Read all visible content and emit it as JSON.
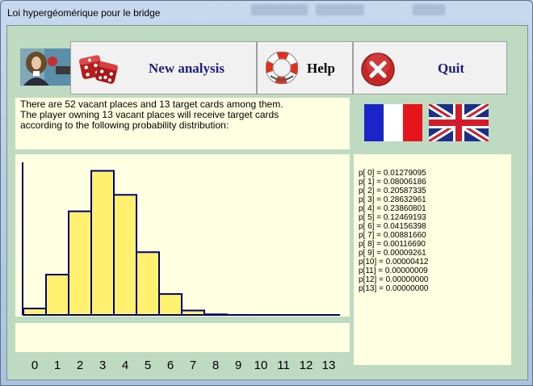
{
  "window": {
    "title": "Loi hypergéomérique pour le bridge"
  },
  "toolbar": {
    "new_analysis_label": "New analysis",
    "help_label": "Help",
    "quit_label": "Quit"
  },
  "info": {
    "lines": [
      "There are 52 vacant places and 13  target cards  among them.",
      "The player owning 13 vacant places will receive  target cards",
      "according to the following probability distribution:"
    ]
  },
  "probabilities": [
    "p[ 0] = 0.01279095",
    "p[ 1] = 0.08006186",
    "p[ 2] = 0.20587335",
    "p[ 3] = 0.28632961",
    "p[ 4] = 0.23860801",
    "p[ 5] = 0.12469193",
    "p[ 6] = 0.04156398",
    "p[ 7] = 0.00881660",
    "p[ 8] = 0.00116690",
    "p[ 9] = 0.00009261",
    "p[10] = 0.00000412",
    "p[11] = 0.00000009",
    "p[12] = 0.00000000",
    "p[13] = 0.00000000"
  ],
  "chart_data": {
    "type": "bar",
    "categories": [
      "0",
      "1",
      "2",
      "3",
      "4",
      "5",
      "6",
      "7",
      "8",
      "9",
      "10",
      "11",
      "12",
      "13"
    ],
    "values": [
      0.01279095,
      0.08006186,
      0.20587335,
      0.28632961,
      0.23860801,
      0.12469193,
      0.04156398,
      0.0088166,
      0.0011669,
      9.261e-05,
      4.12e-06,
      9e-08,
      0.0,
      0.0
    ],
    "ylim": [
      0,
      0.3
    ],
    "bar_color": "#fff06f",
    "edge_color": "#00006e"
  },
  "colors": {
    "panel": "#ffffe1",
    "client": "#bedac1",
    "accent": "#1d1d7d"
  }
}
